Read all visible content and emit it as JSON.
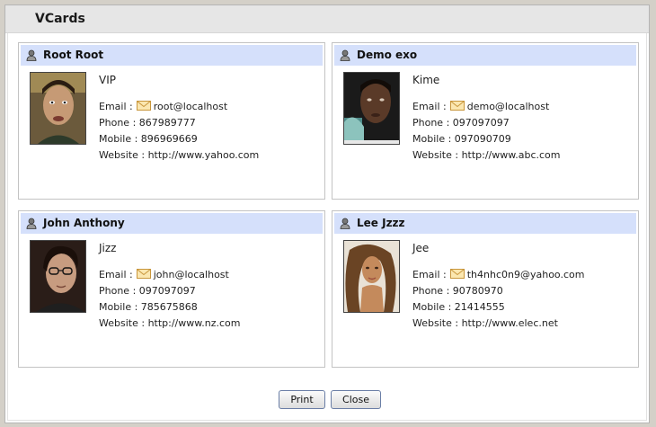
{
  "window": {
    "title": "VCards"
  },
  "labels": {
    "email": "Email :",
    "phone": "Phone :",
    "mobile": "Mobile :",
    "website": "Website :"
  },
  "cards": [
    {
      "name": "Root Root",
      "nickname": "VIP",
      "email": "root@localhost",
      "phone": "867989777",
      "mobile": "896969669",
      "website": "http://www.yahoo.com"
    },
    {
      "name": "Demo exo",
      "nickname": "Kime",
      "email": "demo@localhost",
      "phone": "097097097",
      "mobile": "097090709",
      "website": "http://www.abc.com"
    },
    {
      "name": "John Anthony",
      "nickname": "Jizz",
      "email": "john@localhost",
      "phone": "097097097",
      "mobile": "785675868",
      "website": "http://www.nz.com"
    },
    {
      "name": "Lee Jzzz",
      "nickname": "Jee",
      "email": "th4nhc0n9@yahoo.com",
      "phone": "90780970",
      "mobile": "21414555",
      "website": "http://www.elec.net"
    }
  ],
  "buttons": {
    "print": "Print",
    "close": "Close"
  },
  "colors": {
    "card_header": "#d5e0fb",
    "title_bar": "#e6e6e6",
    "button_border": "#6a7ea6"
  }
}
